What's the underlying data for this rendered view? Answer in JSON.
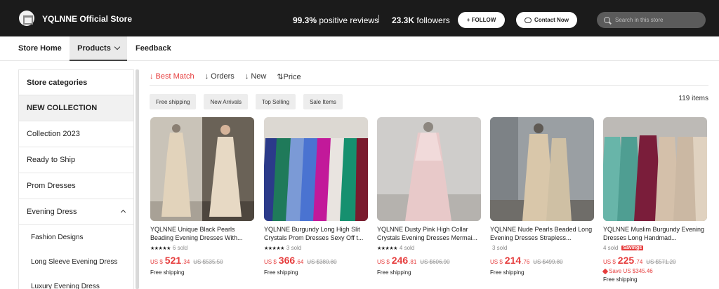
{
  "header": {
    "store_name": "YQLNNE Official Store",
    "positive_reviews_value": "99.3%",
    "positive_reviews_label": "positive reviews",
    "separator": "|",
    "followers_value": "23.3K",
    "followers_label": "followers",
    "follow_button": "+ FOLLOW",
    "contact_button": "Contact Now",
    "search_placeholder": "Search in this store"
  },
  "nav": {
    "store_home": "Store Home",
    "products": "Products",
    "feedback": "Feedback"
  },
  "sidebar": {
    "title": "Store categories",
    "items": [
      {
        "label": "NEW COLLECTION"
      },
      {
        "label": "Collection 2023"
      },
      {
        "label": "Ready to Ship"
      },
      {
        "label": "Prom Dresses"
      },
      {
        "label": "Evening Dress"
      }
    ],
    "sub_items": [
      {
        "label": "Fashion Designs"
      },
      {
        "label": "Long Sleeve Evening Dress"
      },
      {
        "label": "Luxury Evening Dress"
      }
    ]
  },
  "sort": {
    "options": [
      "↓ Best Match",
      "↓ Orders",
      "↓ New",
      "⇅Price"
    ],
    "active_index": 0
  },
  "filters": [
    "Free shipping",
    "New Arrivals",
    "Top Selling",
    "Sale Items"
  ],
  "item_count": "119 items",
  "products": [
    {
      "title": "YQLNNE Unique Black Pearls Beading Evening Dresses With...",
      "stars": "★★★★★",
      "sold": "6 sold",
      "currency": "US $",
      "price_int": "521",
      "price_dec": ".34",
      "old_price": "US $535.50",
      "shipping": "Free shipping",
      "savings_badge": "",
      "save_text": ""
    },
    {
      "title": "YQLNNE Burgundy Long High Slit Crystals Prom Dresses Sexy Off t...",
      "stars": "★★★★★",
      "sold": "3 sold",
      "currency": "US $",
      "price_int": "366",
      "price_dec": ".64",
      "old_price": "US $380.80",
      "shipping": "Free shipping",
      "savings_badge": "",
      "save_text": ""
    },
    {
      "title": "YQLNNE Dusty Pink High Collar Crystals Evening Dresses Mermai...",
      "stars": "★★★★★",
      "sold": "4 sold",
      "currency": "US $",
      "price_int": "246",
      "price_dec": ".81",
      "old_price": "US $606.90",
      "shipping": "Free shipping",
      "savings_badge": "",
      "save_text": ""
    },
    {
      "title": "YQLNNE Nude Pearls Beaded Long Evening Dresses Strapless...",
      "stars": "",
      "sold": "3 sold",
      "currency": "US $",
      "price_int": "214",
      "price_dec": ".76",
      "old_price": "US $499.80",
      "shipping": "Free shipping",
      "savings_badge": "",
      "save_text": ""
    },
    {
      "title": "YQLNNE Muslim Burgundy Evening Dresses Long Handmad...",
      "stars": "",
      "sold": "4 sold",
      "currency": "US $",
      "price_int": "225",
      "price_dec": ".74",
      "old_price": "US $571.20",
      "shipping": "Free shipping",
      "savings_badge": "Savings",
      "save_text": "Save US $345.46"
    }
  ],
  "colors": {
    "accent_red": "#e63d3d",
    "header_bg": "#1b1b1b"
  }
}
